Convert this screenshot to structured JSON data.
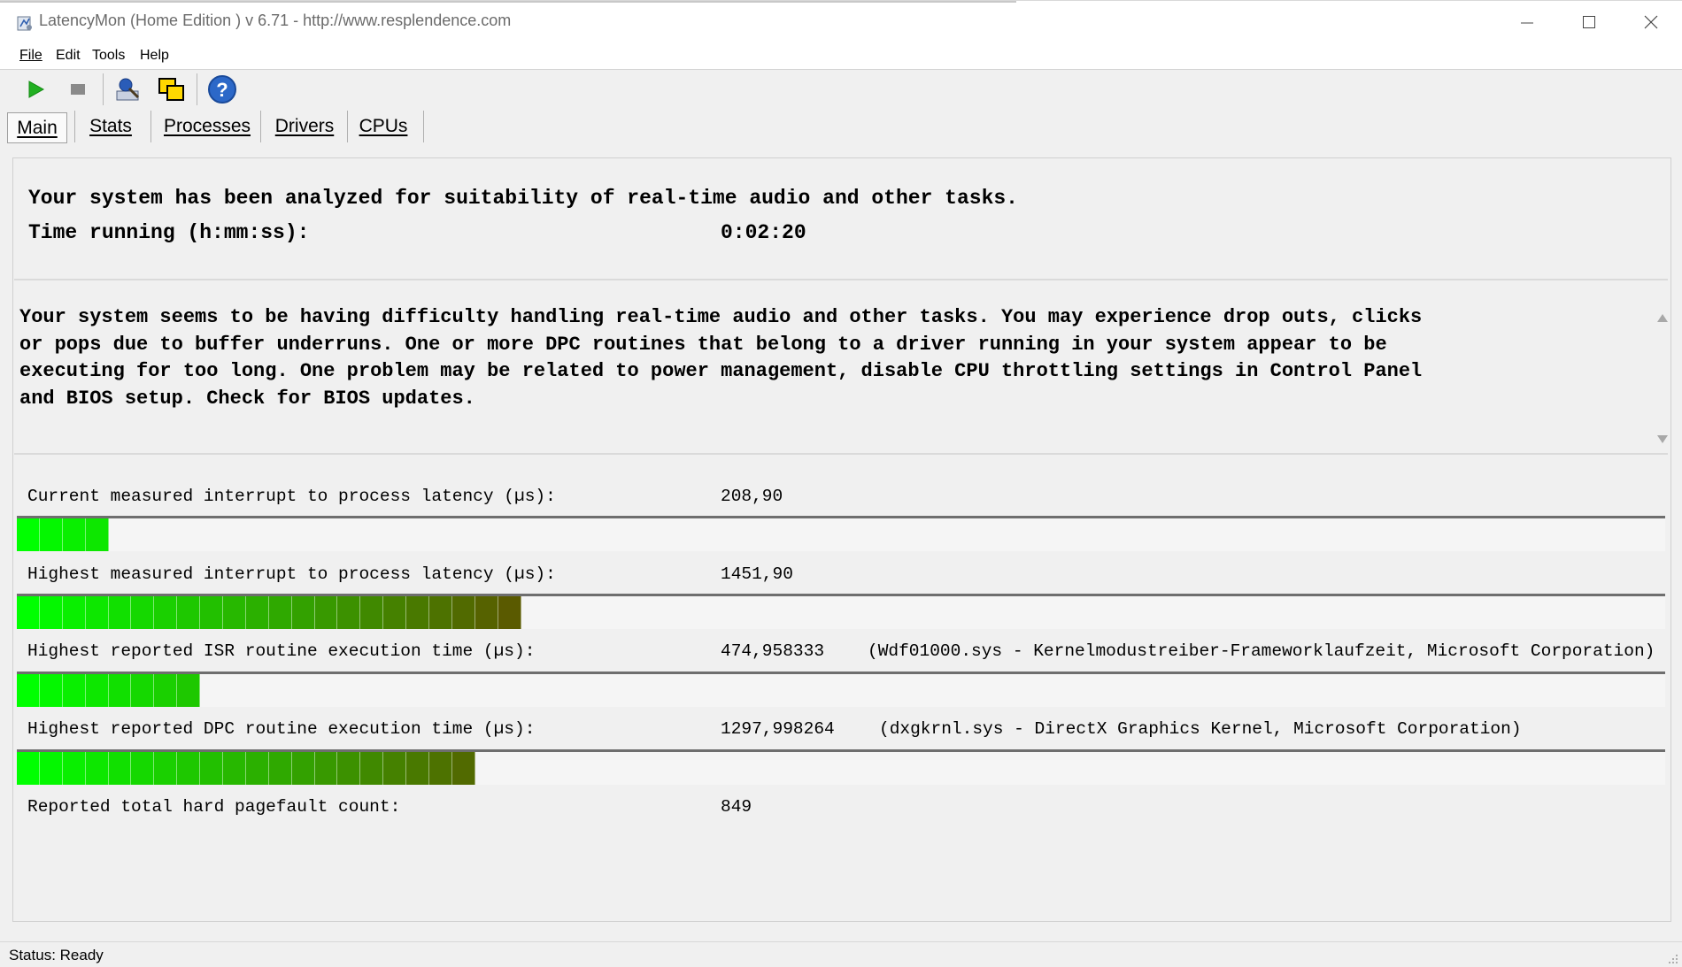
{
  "window": {
    "title": "LatencyMon  (Home Edition )  v 6.71 - http://www.resplendence.com",
    "controls": [
      "minimize",
      "maximize",
      "close"
    ]
  },
  "menu": [
    "File",
    "Edit",
    "Tools",
    "Help"
  ],
  "toolbar": {
    "icons": [
      "start-icon",
      "stop-icon",
      "analyze-icon",
      "window-icon",
      "help-icon"
    ]
  },
  "tabs": [
    "Main",
    "Stats",
    "Processes",
    "Drivers",
    "CPUs"
  ],
  "summary": {
    "headline": "Your system has been analyzed for suitability of real-time audio and other tasks.",
    "time_label": "Time running (h:mm:ss):",
    "time_value": "0:02:20"
  },
  "advice": "Your system seems to be having difficulty handling real-time audio and other tasks. You may experience drop outs, clicks\nor pops due to buffer underruns. One or more DPC routines that belong to a driver running in your system appear to be\nexecuting for too long. One problem may be related to power management, disable CPU throttling settings in Control Panel\nand BIOS setup. Check for BIOS updates.",
  "metrics": [
    {
      "label": "Current measured interrupt to process latency (µs):",
      "value": "208,90",
      "extra": "",
      "bar_segments": 4
    },
    {
      "label": "Highest measured interrupt to process latency (µs):",
      "value": "1451,90",
      "extra": "",
      "bar_segments": 22
    },
    {
      "label": "Highest reported ISR routine execution time (µs):",
      "value": "474,958333",
      "extra": "(Wdf01000.sys - Kernelmodustreiber-Frameworklaufzeit, Microsoft Corporation)",
      "bar_segments": 8
    },
    {
      "label": "Highest reported DPC routine execution time (µs):",
      "value": "1297,998264",
      "extra": "(dxgkrnl.sys - DirectX Graphics Kernel, Microsoft Corporation)",
      "bar_segments": 20
    },
    {
      "label": "Reported total hard pagefault count:",
      "value": "849",
      "extra": ""
    }
  ],
  "bar_colors": {
    "start": "#00ff00",
    "end": "#5a5a00",
    "track": "#f5f5f5"
  },
  "status": "Status: Ready"
}
